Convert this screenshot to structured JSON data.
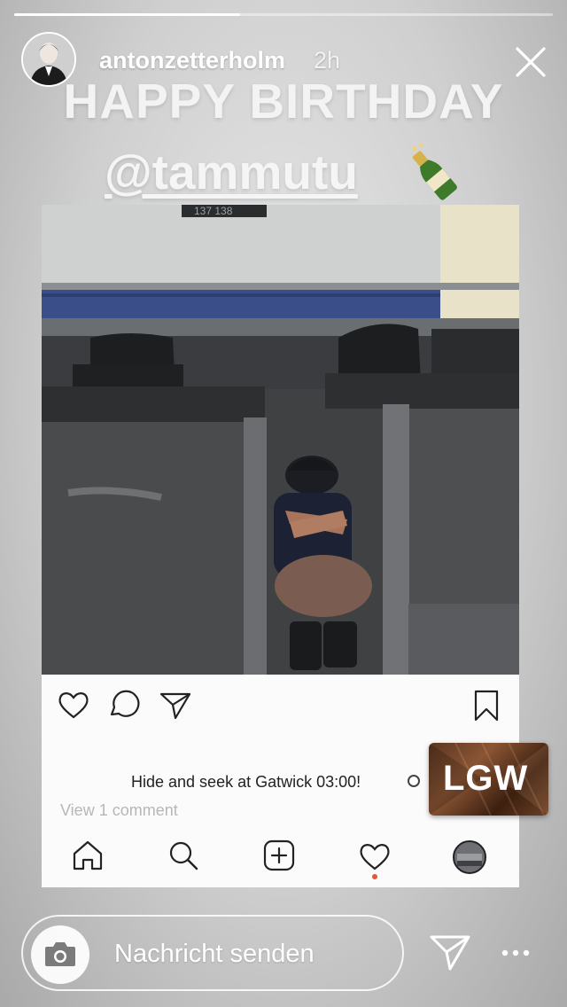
{
  "story": {
    "progress": 0.42,
    "username": "antonzetterholm",
    "time": "2h",
    "headline": "HAPPY BIRTHDAY",
    "mention": "@tammutu"
  },
  "post": {
    "photo_signage": "137  138",
    "caption": "Hide and seek at Gatwick 03:00!",
    "comments_link": "View 1 comment",
    "location_sticker": "LGW",
    "action_icons": [
      "heart-icon",
      "comment-icon",
      "share-icon",
      "bookmark-icon"
    ],
    "nav_icons": [
      "home-icon",
      "search-icon",
      "add-icon",
      "activity-heart-icon",
      "profile-icon"
    ]
  },
  "reply": {
    "placeholder": "Nachricht senden"
  },
  "colors": {
    "accent_dot": "#e8543a",
    "text_light": "#ffffff"
  }
}
